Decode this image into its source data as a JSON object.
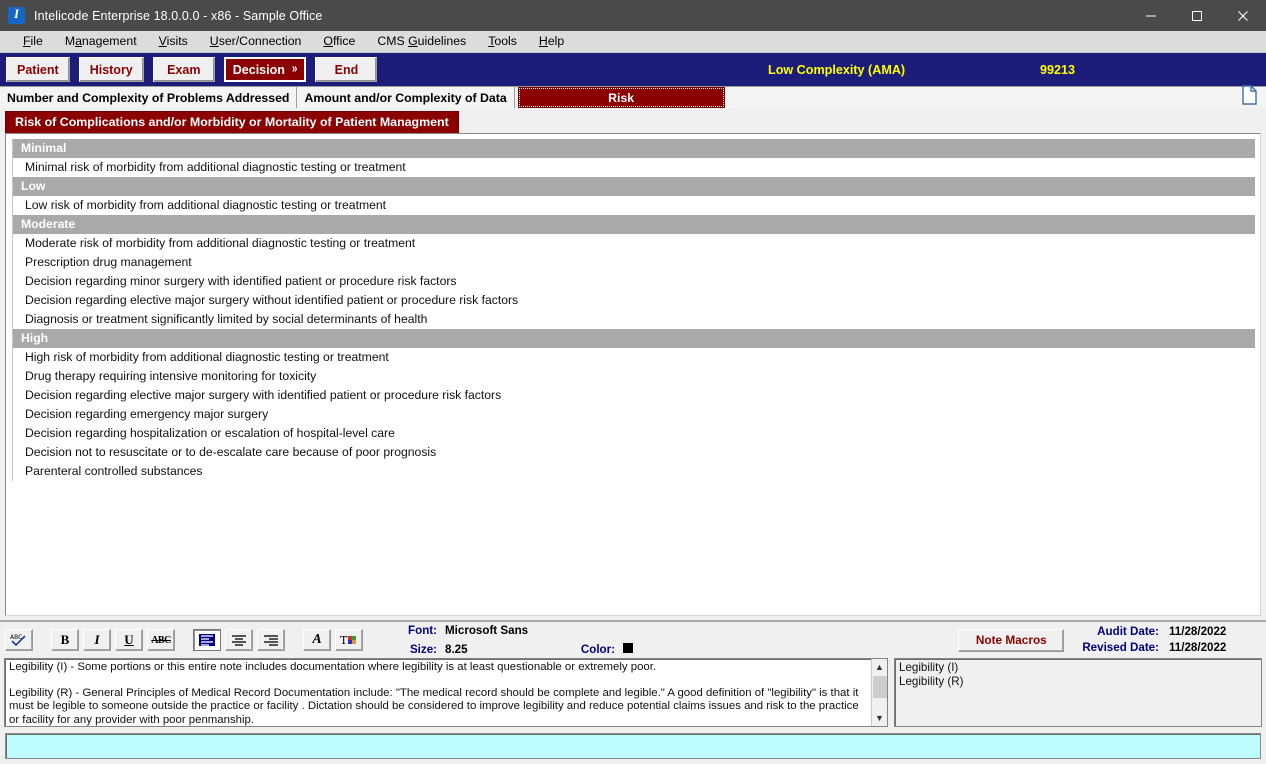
{
  "window": {
    "title": "Intelicode Enterprise 18.0.0.0 - x86 - Sample Office",
    "app_icon": "app-logo-icon",
    "minimize": "minimize-icon",
    "maximize": "maximize-icon",
    "close": "close-icon"
  },
  "menubar": {
    "items": [
      {
        "label": "File",
        "accel": "F"
      },
      {
        "label": "Management",
        "accel": "M"
      },
      {
        "label": "Visits",
        "accel": "V"
      },
      {
        "label": "User/Connection",
        "accel": "U"
      },
      {
        "label": "Office",
        "accel": "O"
      },
      {
        "label": "CMS Guidelines",
        "accel": "G"
      },
      {
        "label": "Tools",
        "accel": "T"
      },
      {
        "label": "Help",
        "accel": "H"
      }
    ]
  },
  "navbar": {
    "buttons": [
      {
        "label": "Patient",
        "active": false
      },
      {
        "label": "History",
        "active": false
      },
      {
        "label": "Exam",
        "active": false
      },
      {
        "label": "Decision",
        "active": true,
        "chevron": "»"
      },
      {
        "label": "End",
        "active": false
      }
    ],
    "complexity": "Low Complexity (AMA)",
    "code": "99213",
    "accent_bg": "#1c1c7a",
    "accent_text": "#ffff00"
  },
  "tabs": {
    "items": [
      {
        "label": "Number and Complexity of Problems Addressed",
        "selected": false
      },
      {
        "label": "Amount and/or Complexity of Data",
        "selected": false
      },
      {
        "label": "Risk",
        "selected": true
      }
    ],
    "page_icon": "document-page-icon"
  },
  "main": {
    "section_title": "Risk of Complications and/or Morbidity or Mortality of Patient Managment",
    "section_bg": "#8b0000",
    "group_bg": "#a9a9a9",
    "rows": [
      {
        "type": "group",
        "label": "Minimal"
      },
      {
        "type": "item",
        "label": "Minimal risk of morbidity from additional diagnostic testing or treatment"
      },
      {
        "type": "group",
        "label": "Low"
      },
      {
        "type": "item",
        "label": "Low risk of morbidity from additional diagnostic testing or treatment"
      },
      {
        "type": "group",
        "label": "Moderate"
      },
      {
        "type": "item",
        "label": "Moderate risk of morbidity from additional diagnostic testing or treatment"
      },
      {
        "type": "item",
        "label": "Prescription drug management"
      },
      {
        "type": "item",
        "label": "Decision regarding minor surgery with identified patient or procedure risk factors"
      },
      {
        "type": "item",
        "label": "Decision regarding elective major surgery without identified patient or procedure risk factors"
      },
      {
        "type": "item",
        "label": "Diagnosis or treatment significantly limited by social determinants of health"
      },
      {
        "type": "group",
        "label": "High"
      },
      {
        "type": "item",
        "label": "High risk of morbidity from additional diagnostic testing or treatment"
      },
      {
        "type": "item",
        "label": "Drug therapy requiring intensive monitoring for toxicity"
      },
      {
        "type": "item",
        "label": "Decision regarding elective major surgery with identified patient or procedure risk factors"
      },
      {
        "type": "item",
        "label": "Decision regarding emergency major surgery"
      },
      {
        "type": "item",
        "label": "Decision regarding hospitalization or escalation of hospital-level care"
      },
      {
        "type": "item",
        "label": "Decision not to resuscitate or to de-escalate care because of poor prognosis"
      },
      {
        "type": "item",
        "label": "Parenteral controlled substances"
      }
    ]
  },
  "format_toolbar": {
    "buttons": [
      {
        "name": "spellcheck-icon",
        "glyph": "ABC",
        "pressed": false
      },
      {
        "name": "bold-icon",
        "glyph": "B",
        "pressed": false
      },
      {
        "name": "italic-icon",
        "glyph": "I",
        "pressed": false
      },
      {
        "name": "underline-icon",
        "glyph": "U",
        "pressed": false
      },
      {
        "name": "strikethrough-icon",
        "glyph": "ABC",
        "pressed": false
      },
      {
        "name": "align-left-icon",
        "glyph": "",
        "pressed": true
      },
      {
        "name": "align-center-icon",
        "glyph": "",
        "pressed": false
      },
      {
        "name": "align-right-icon",
        "glyph": "",
        "pressed": false
      },
      {
        "name": "font-style-icon",
        "glyph": "A",
        "pressed": false
      },
      {
        "name": "text-color-icon",
        "glyph": "T",
        "pressed": false
      }
    ],
    "font_label": "Font:",
    "font_value": "Microsoft Sans",
    "size_label": "Size:",
    "size_value": "8.25",
    "color_label": "Color:",
    "color_value": "#000000"
  },
  "note_macros": {
    "button_label": "Note Macros",
    "audit_date_label": "Audit Date:",
    "audit_date_value": "11/28/2022",
    "revised_date_label": "Revised Date:",
    "revised_date_value": "11/28/2022"
  },
  "note_editor": {
    "paragraphs": [
      "Legibility (I) - Some portions or this entire note includes documentation where legibility is at least questionable or extremely poor.",
      "Legibility (R) - General Principles of Medical Record Documentation include: \"The medical record should be complete and legible.\"  A good definition of \"legibility\" is that it must be legible to someone outside the practice or facility .  Dictation should be considered to improve legibility and reduce potential claims issues and risk to the practice or facility for any provider with poor penmanship."
    ],
    "scroll_up": "scroll-up-icon",
    "scroll_down": "scroll-down-icon"
  },
  "macro_list": {
    "items": [
      "Legibility (I)",
      "Legibility (R)"
    ]
  },
  "status_bar": {
    "text": "",
    "bg": "#bdfcff"
  }
}
